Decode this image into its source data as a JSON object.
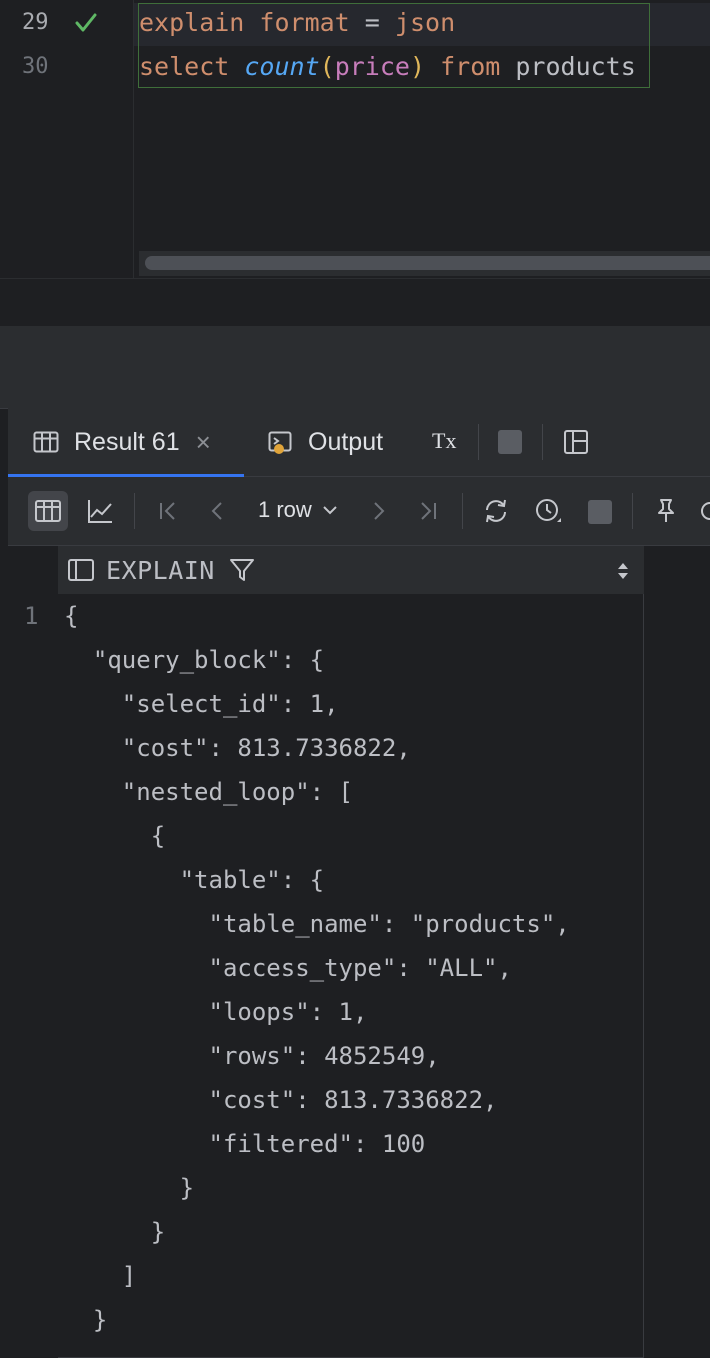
{
  "editor": {
    "lines": [
      {
        "number": "29",
        "status": "check-icon"
      },
      {
        "number": "30"
      }
    ],
    "line1": {
      "kw1": "explain",
      "kw2": "format",
      "op": "=",
      "kw3": "json"
    },
    "line2": {
      "kw_select": "select",
      "fn": "count",
      "paren_open": "(",
      "col": "price",
      "paren_close": ")",
      "kw_from": "from",
      "table": "products"
    }
  },
  "tabs": {
    "result_label": "Result 61",
    "close": "×",
    "output_label": "Output",
    "tx_label": "Tx"
  },
  "toolbar": {
    "rows_label": "1 row"
  },
  "result": {
    "header_label": "EXPLAIN",
    "line_number": "1",
    "json_lines": [
      "{",
      "  \"query_block\": {",
      "    \"select_id\": 1,",
      "    \"cost\": 813.7336822,",
      "    \"nested_loop\": [",
      "      {",
      "        \"table\": {",
      "          \"table_name\": \"products\",",
      "          \"access_type\": \"ALL\",",
      "          \"loops\": 1,",
      "          \"rows\": 4852549,",
      "          \"cost\": 813.7336822,",
      "          \"filtered\": 100",
      "        }",
      "      }",
      "    ]",
      "  }"
    ]
  },
  "colors": {
    "keyword": "#cf8e6d",
    "function": "#56a8f5",
    "column": "#c77dbb",
    "paren": "#e0b75b",
    "accent": "#3574f0",
    "check": "#5fb865"
  }
}
